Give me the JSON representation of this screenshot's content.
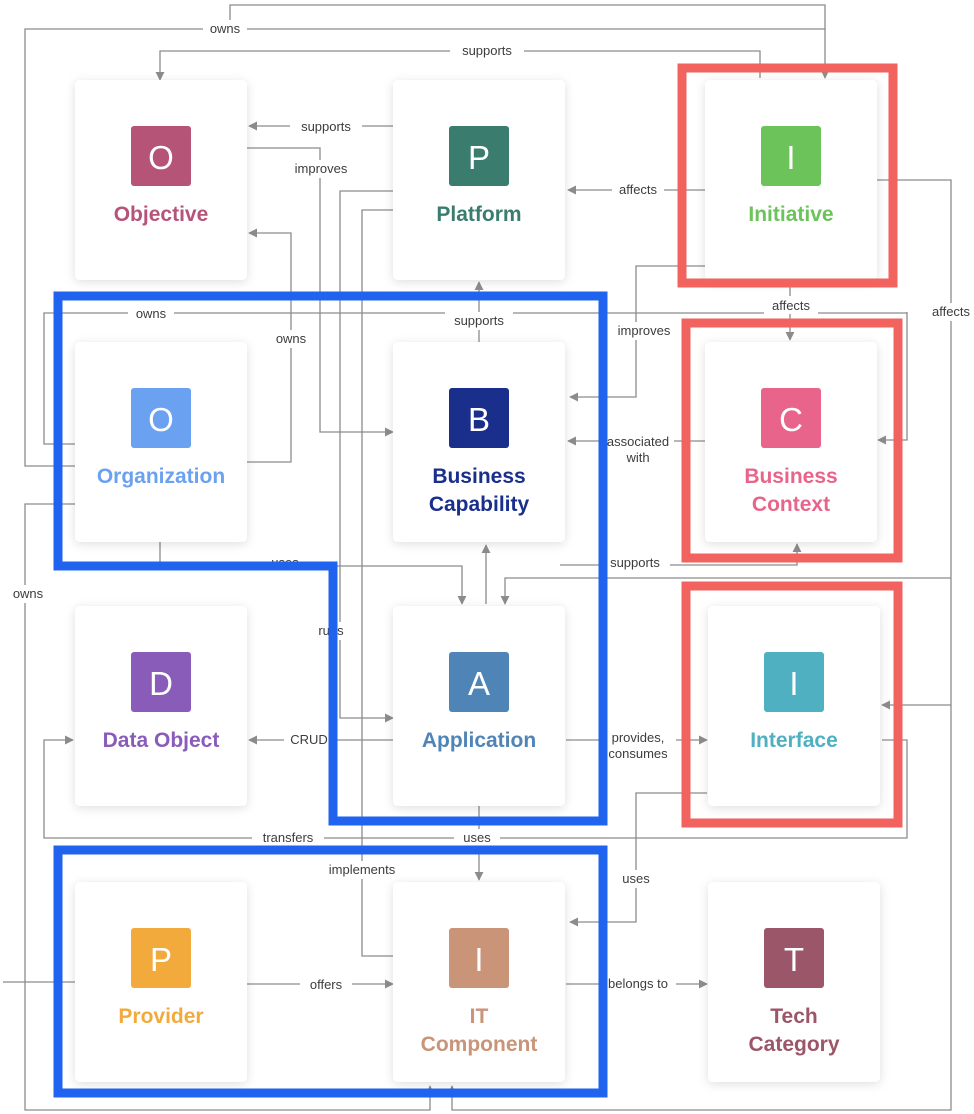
{
  "nodes": [
    {
      "id": "objective",
      "letter": "O",
      "title": [
        "Objective"
      ],
      "icon_color": "#b65478",
      "text_color": "#b65478"
    },
    {
      "id": "platform",
      "letter": "P",
      "title": [
        "Platform"
      ],
      "icon_color": "#3a7d6f",
      "text_color": "#3a7d6f"
    },
    {
      "id": "initiative",
      "letter": "I",
      "title": [
        "Initiative"
      ],
      "icon_color": "#6cc35a",
      "text_color": "#6cc35a"
    },
    {
      "id": "organization",
      "letter": "O",
      "title": [
        "Organization"
      ],
      "icon_color": "#6aa1f0",
      "text_color": "#6aa1f0"
    },
    {
      "id": "business-capability",
      "letter": "B",
      "title": [
        "Business",
        "Capability"
      ],
      "icon_color": "#1a2f8c",
      "text_color": "#1a2f8c"
    },
    {
      "id": "business-context",
      "letter": "C",
      "title": [
        "Business",
        "Context"
      ],
      "icon_color": "#e8648a",
      "text_color": "#e8648a"
    },
    {
      "id": "data-object",
      "letter": "D",
      "title": [
        "Data Object"
      ],
      "icon_color": "#8a5cba",
      "text_color": "#8a5cba"
    },
    {
      "id": "application",
      "letter": "A",
      "title": [
        "Application"
      ],
      "icon_color": "#4f84b6",
      "text_color": "#4f84b6"
    },
    {
      "id": "interface",
      "letter": "I",
      "title": [
        "Interface"
      ],
      "icon_color": "#4fb0c2",
      "text_color": "#4fb0c2"
    },
    {
      "id": "provider",
      "letter": "P",
      "title": [
        "Provider"
      ],
      "icon_color": "#f2aa3c",
      "text_color": "#f2aa3c"
    },
    {
      "id": "it-component",
      "letter": "I",
      "title": [
        "IT",
        "Component"
      ],
      "icon_color": "#c99478",
      "text_color": "#c99478"
    },
    {
      "id": "tech-category",
      "letter": "T",
      "title": [
        "Tech",
        "Category"
      ],
      "icon_color": "#9c566a",
      "text_color": "#9c566a"
    }
  ],
  "labels": {
    "owns_top": "owns",
    "supports_top": "supports",
    "supports_platform_objective": "supports",
    "improves_platform": "improves",
    "affects_initiative_platform": "affects",
    "affects_initiative_context": "affects",
    "affects_right": "affects",
    "owns_organization": "owns",
    "owns_objective": "owns",
    "supports_capability_platform": "supports",
    "improves_initiative": "improves",
    "associated_with": "associated with",
    "uses_organization": "uses",
    "supports_context": "supports",
    "runs": "runs",
    "owns_left": "owns",
    "crud": "CRUD",
    "provides_consumes": "provides, consumes",
    "transfers": "transfers",
    "uses_application": "uses",
    "implements": "implements",
    "uses_interface": "uses",
    "offers": "offers",
    "belongs_to": "belongs to"
  },
  "highlight_colors": {
    "red": "#f2625f",
    "blue": "#1f63ef"
  },
  "connector_color": "#8c8c8c"
}
